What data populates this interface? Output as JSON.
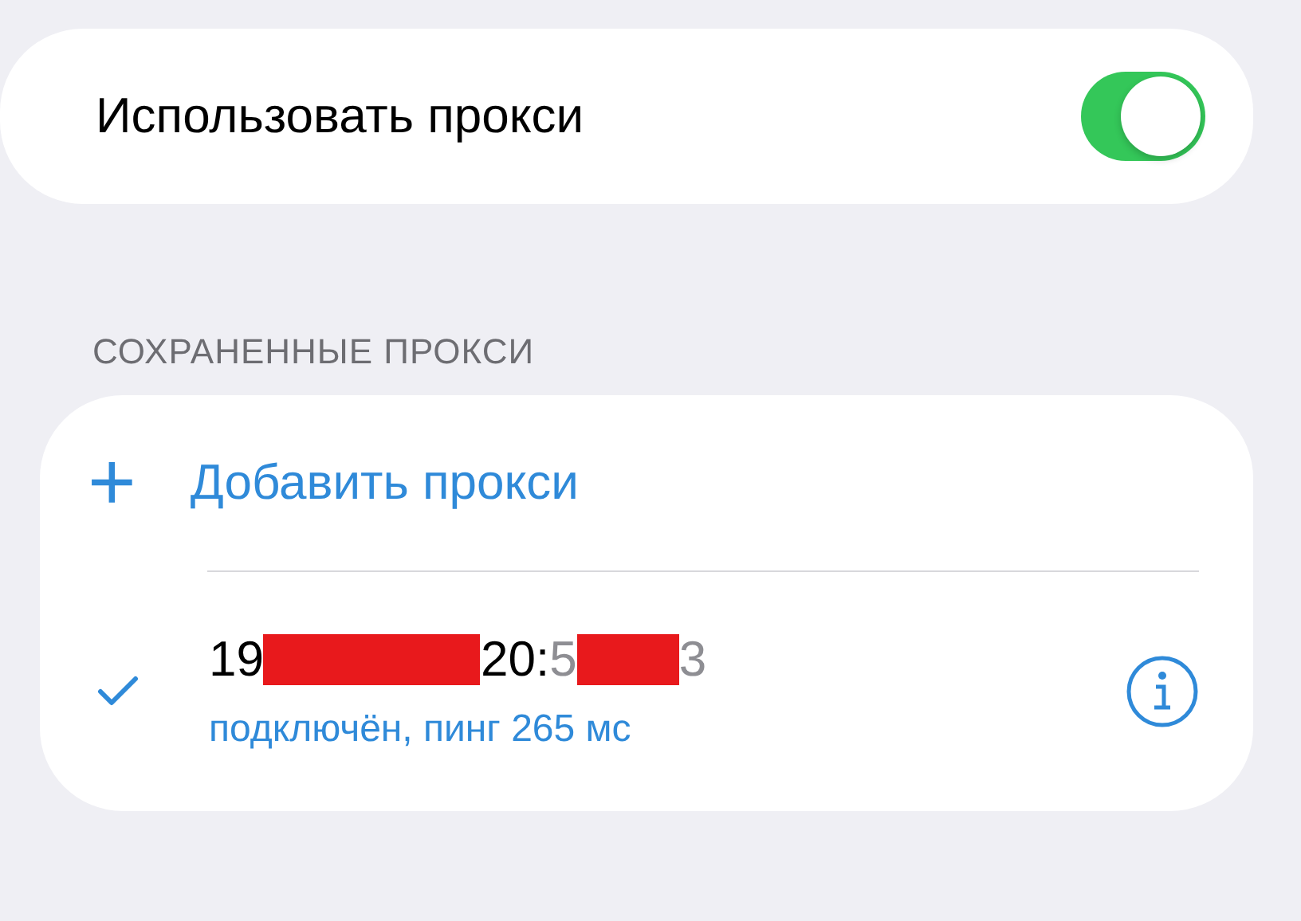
{
  "proxy_toggle": {
    "label": "Использовать прокси",
    "on": true
  },
  "saved_section": {
    "header": "СОХРАНЕННЫЕ ПРОКСИ",
    "add_button": {
      "icon": "+",
      "label": "Добавить прокси"
    },
    "proxies": [
      {
        "selected": true,
        "address": [
          {
            "kind": "host",
            "text": "19"
          },
          {
            "kind": "redacted"
          },
          {
            "kind": "host",
            "text": "20:"
          },
          {
            "kind": "port",
            "text": "5"
          },
          {
            "kind": "redacted"
          },
          {
            "kind": "port",
            "text": "3"
          }
        ],
        "status": "подключён, пинг 265 мс"
      }
    ]
  }
}
